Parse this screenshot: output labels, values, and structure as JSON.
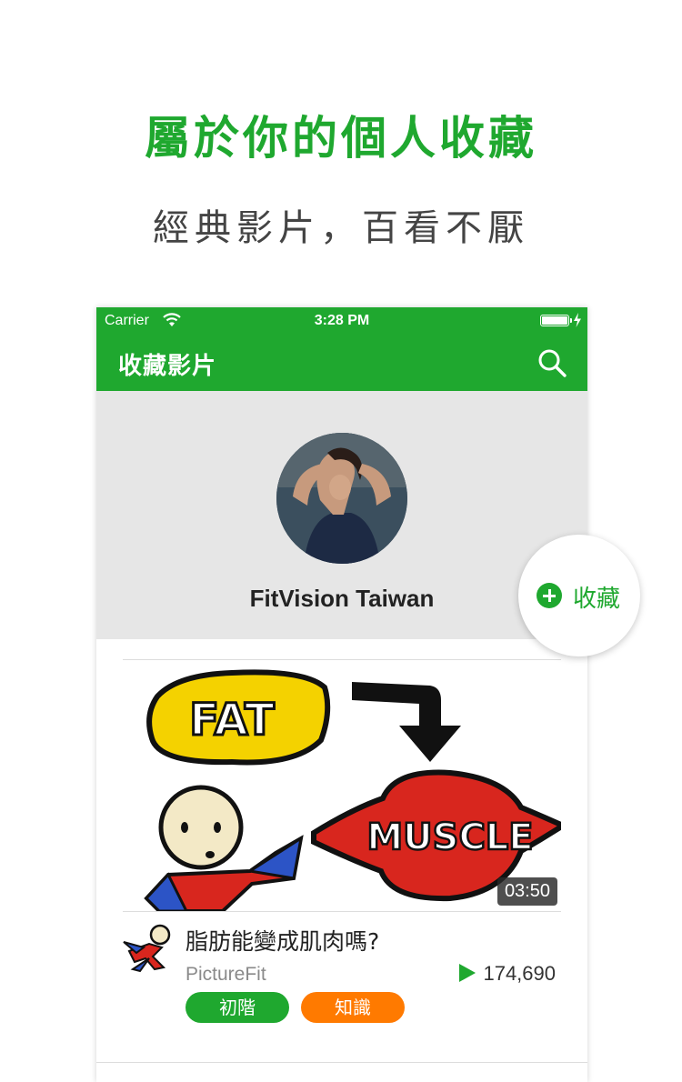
{
  "promo": {
    "headline": "屬於你的個人收藏",
    "subline": "經典影片，百看不厭"
  },
  "status_bar": {
    "carrier": "Carrier",
    "time": "3:28 PM"
  },
  "nav": {
    "title": "收藏影片",
    "search_icon": "search-icon"
  },
  "profile": {
    "channel_name": "FitVision Taiwan"
  },
  "fab": {
    "label": "收藏",
    "icon": "plus-circle-icon"
  },
  "video": {
    "duration": "03:50",
    "title": "脂肪能變成肌肉嗎?",
    "uploader": "PictureFit",
    "views": "174,690",
    "tags": [
      "初階",
      "知識"
    ],
    "thumbnail_text": {
      "fat": "FAT",
      "muscle": "MUSCLE"
    }
  },
  "colors": {
    "brand_green": "#1fa82f",
    "tag_orange": "#ff7a00"
  }
}
